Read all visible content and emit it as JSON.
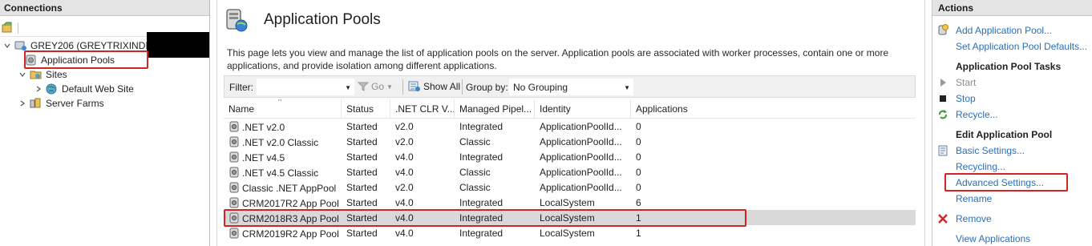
{
  "connections": {
    "title": "Connections",
    "tree": {
      "server": "GREY206 (GREYTRIXINDIA\\",
      "app_pools": "Application Pools",
      "sites": "Sites",
      "default_site": "Default Web Site",
      "server_farms": "Server Farms"
    }
  },
  "main": {
    "title": "Application Pools",
    "description": "This page lets you view and manage the list of application pools on the server. Application pools are associated with worker processes, contain one or more applications, and provide isolation among different applications.",
    "filter": {
      "label": "Filter:",
      "value": "",
      "go": "Go",
      "show_all": "Show All",
      "group_by_label": "Group by:",
      "group_by_value": "No Grouping"
    },
    "columns": [
      "Name",
      "Status",
      ".NET CLR V...",
      "Managed Pipel...",
      "Identity",
      "Applications"
    ],
    "rows": [
      [
        ".NET v2.0",
        "Started",
        "v2.0",
        "Integrated",
        "ApplicationPoolId...",
        "0"
      ],
      [
        ".NET v2.0 Classic",
        "Started",
        "v2.0",
        "Classic",
        "ApplicationPoolId...",
        "0"
      ],
      [
        ".NET v4.5",
        "Started",
        "v4.0",
        "Integrated",
        "ApplicationPoolId...",
        "0"
      ],
      [
        ".NET v4.5 Classic",
        "Started",
        "v4.0",
        "Classic",
        "ApplicationPoolId...",
        "0"
      ],
      [
        "Classic .NET AppPool",
        "Started",
        "v2.0",
        "Classic",
        "ApplicationPoolId...",
        "0"
      ],
      [
        "CRM2017R2 App Pool",
        "Started",
        "v4.0",
        "Integrated",
        "LocalSystem",
        "6"
      ],
      [
        "CRM2018R3 App Pool",
        "Started",
        "v4.0",
        "Integrated",
        "LocalSystem",
        "1"
      ],
      [
        "CRM2019R2 App Pool",
        "Started",
        "v4.0",
        "Integrated",
        "LocalSystem",
        "1"
      ]
    ]
  },
  "actions": {
    "title": "Actions",
    "add_pool": "Add Application Pool...",
    "set_defaults": "Set Application Pool Defaults...",
    "tasks_header": "Application Pool Tasks",
    "start": "Start",
    "stop": "Stop",
    "recycle": "Recycle...",
    "edit_header": "Edit Application Pool",
    "basic_settings": "Basic Settings...",
    "recycling": "Recycling...",
    "advanced_settings": "Advanced Settings...",
    "rename": "Rename",
    "remove": "Remove",
    "view_apps": "View Applications"
  },
  "colors": {
    "link": "#2a6fb8",
    "highlight_box": "#d32424",
    "selected_row": "#d9d9d9",
    "header_bg": "#e4e4e4"
  }
}
